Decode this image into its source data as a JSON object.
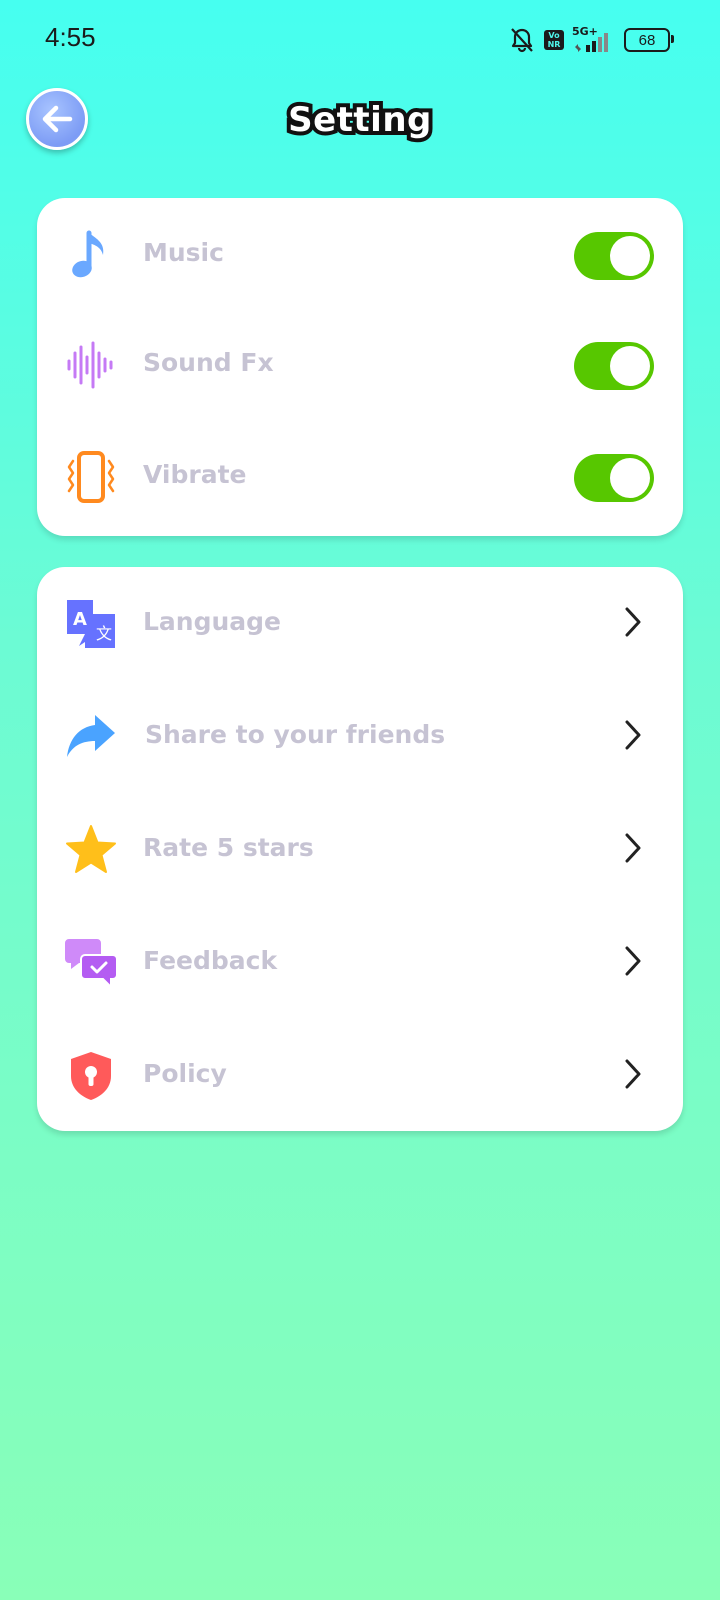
{
  "status_bar": {
    "time": "4:55",
    "battery": "68",
    "network": "5G+",
    "volte": "Vo NR"
  },
  "header": {
    "title": "Setting"
  },
  "audio_settings": [
    {
      "label": "Music",
      "icon": "music-note-icon",
      "enabled": true
    },
    {
      "label": "Sound Fx",
      "icon": "sound-wave-icon",
      "enabled": true
    },
    {
      "label": "Vibrate",
      "icon": "vibrate-phone-icon",
      "enabled": true
    }
  ],
  "menu_items": [
    {
      "label": "Language",
      "icon": "translate-icon"
    },
    {
      "label": "Share to your friends",
      "icon": "share-arrow-icon"
    },
    {
      "label": "Rate 5 stars",
      "icon": "star-icon"
    },
    {
      "label": "Feedback",
      "icon": "chat-bubbles-icon"
    },
    {
      "label": "Policy",
      "icon": "shield-lock-icon"
    }
  ],
  "colors": {
    "toggle_on": "#57c700",
    "label_text": "#c6c3d3",
    "background_top": "#46fff0",
    "background_bottom": "#89ffb8"
  }
}
